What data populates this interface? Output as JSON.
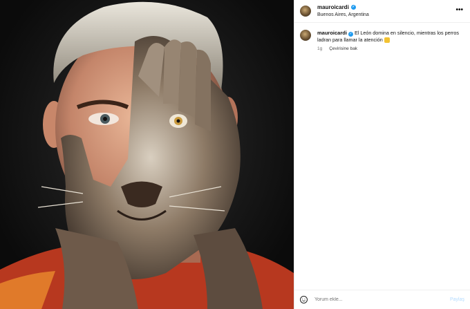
{
  "header": {
    "username": "mauroicardi",
    "location": "Buenos Aires, Argentina",
    "more_glyph": "•••"
  },
  "caption": {
    "username": "mauroicardi",
    "text": "El León domina en silencio, mientras los perros ladran para llamar la atención",
    "emoji": "lion-face",
    "time": "1g",
    "translate": "Çevirisine bak"
  },
  "footer": {
    "placeholder": "Yorum ekle...",
    "post_label": "Paylaş"
  },
  "icons": {
    "verified": "verified-badge-icon",
    "more": "more-options-icon",
    "emoji": "emoji-smile-icon"
  },
  "colors": {
    "verified": "#1f9bf0",
    "post_disabled": "#b3dbff",
    "jersey": "#b7381f"
  }
}
